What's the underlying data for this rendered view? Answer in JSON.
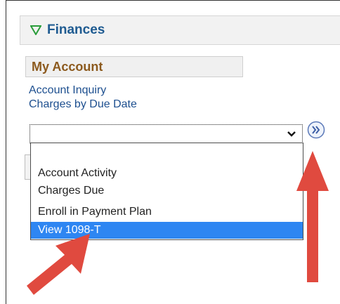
{
  "finances": {
    "title": "Finances"
  },
  "my_account": {
    "section_title": "My Account",
    "links": [
      "Account Inquiry",
      "Charges by Due Date"
    ]
  },
  "dropdown": {
    "selected_value": "",
    "options": [
      "",
      "Account Activity",
      "Charges Due",
      "Enroll in Payment Plan",
      "View 1098-T"
    ],
    "highlighted": "View 1098-T"
  },
  "colors": {
    "link": "#1d4f8f",
    "section_title": "#8c5a1e",
    "highlight": "#2e86f2",
    "annotation_arrow": "#e04a3f"
  },
  "icons": {
    "collapse": "triangle-down-icon",
    "go": "double-chevron-right-icon",
    "select": "chevron-down-icon"
  }
}
